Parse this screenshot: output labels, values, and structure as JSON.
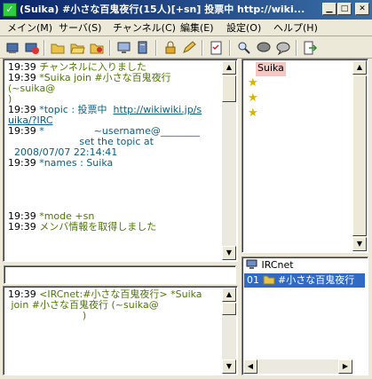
{
  "window": {
    "title": "(Suika) #小さな百鬼夜行(15人)[+sn] 投票中 http://wiki...",
    "app_icon": "app-icon",
    "controls": {
      "minimize": "0",
      "maximize": "1",
      "close": "r"
    }
  },
  "menu": {
    "items": [
      "メイン(M)",
      "サーバ(S)",
      "チャンネル(C)",
      "編集(E)",
      "設定(O)",
      "ヘルプ(H)"
    ]
  },
  "toolbar": {
    "icons": [
      "connect-icon",
      "disconnect-icon",
      "folder-icon",
      "folder-open-icon",
      "folder-star-icon",
      "monitor-icon",
      "server-icon",
      "lock-icon",
      "pencil-icon",
      "checklist-icon",
      "search-icon",
      "speech-icon",
      "balloon-icon",
      "exit-icon"
    ]
  },
  "colors": {
    "accent": "#316ac5",
    "titlebar": "#0a246a",
    "olive_text": "#4c7a00",
    "teal_text": "#0a5f82",
    "nick_highlight": "#f4c7c3"
  },
  "channel_log": {
    "lines": [
      {
        "ts": "19:39",
        "text": " チャンネルに入りました",
        "cls": "c-olive"
      },
      {
        "ts": "19:39",
        "text": " *Suika join #小さな百鬼夜行",
        "cls": "c-olive"
      },
      {
        "ts": "",
        "text": "(~suika@",
        "cls": "c-olive"
      },
      {
        "ts": "",
        "text": ")",
        "cls": "c-olive"
      },
      {
        "ts": "19:39",
        "text": " *topic : 投票中  ",
        "cls": "c-teal",
        "link": "http://wikiwiki.jp/s"
      },
      {
        "ts": "",
        "text": "",
        "cls": "c-teal",
        "link": "uika/?IRC"
      },
      {
        "ts": "19:39",
        "text": " *                ~username@________",
        "cls": "c-teal"
      },
      {
        "ts": "",
        "text": "                       set the topic at",
        "cls": "c-teal"
      },
      {
        "ts": "",
        "text": "  2008/07/07 22:14:41",
        "cls": "c-teal"
      },
      {
        "ts": "19:39",
        "text": " *names : Suika",
        "cls": "c-teal"
      },
      {
        "ts": "",
        "text": "",
        "cls": "c-black"
      },
      {
        "ts": "",
        "text": "",
        "cls": "c-black"
      },
      {
        "ts": "",
        "text": "",
        "cls": "c-black"
      },
      {
        "ts": "",
        "text": "",
        "cls": "c-black"
      },
      {
        "ts": "19:39",
        "text": " *mode +sn",
        "cls": "c-olive"
      },
      {
        "ts": "19:39",
        "text": " メンバ情報を取得しました",
        "cls": "c-olive"
      }
    ]
  },
  "input": {
    "value": ""
  },
  "server_log": {
    "lines": [
      {
        "ts": "19:39",
        "text": " <IRCnet:#小さな百鬼夜行> *Suika",
        "cls": "c-olive"
      },
      {
        "ts": "",
        "text": " join #小さな百鬼夜行 (~suika@",
        "cls": "c-olive"
      },
      {
        "ts": "",
        "text": "                        )",
        "cls": "c-olive"
      }
    ]
  },
  "nicklist": {
    "self": "Suika",
    "stars": [
      "star-icon",
      "star-icon",
      "star-icon"
    ]
  },
  "channel_tree": {
    "server": "IRCnet",
    "channel_number": "01",
    "channel_name": "#小さな百鬼夜行"
  }
}
